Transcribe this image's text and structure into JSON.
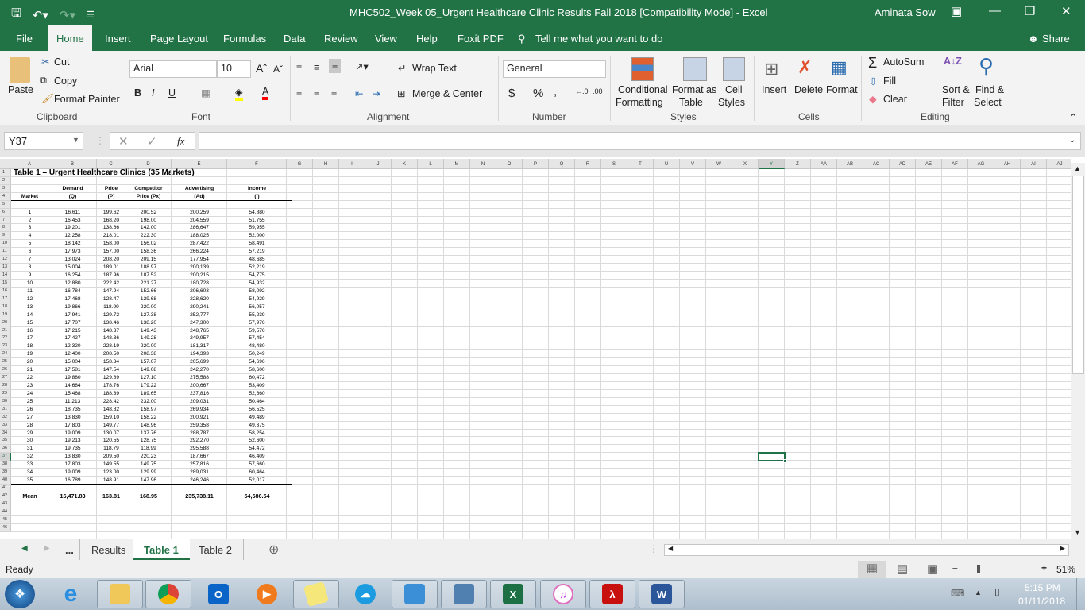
{
  "titlebar": {
    "title": "MHC502_Week 05_Urgent Healthcare Clinic Results Fall 2018  [Compatibility Mode]  -  Excel",
    "user": "Aminata Sow"
  },
  "tabs": [
    "File",
    "Home",
    "Insert",
    "Page Layout",
    "Formulas",
    "Data",
    "Review",
    "View",
    "Help",
    "Foxit PDF"
  ],
  "tell_me": "Tell me what you want to do",
  "share": "Share",
  "ribbon": {
    "clipboard": {
      "paste": "Paste",
      "cut": "Cut",
      "copy": "Copy",
      "format_painter": "Format Painter",
      "label": "Clipboard"
    },
    "font": {
      "name": "Arial",
      "size": "10",
      "label": "Font",
      "bold": "B",
      "italic": "I",
      "underline": "U"
    },
    "alignment": {
      "wrap_text": "Wrap Text",
      "merge_center": "Merge & Center",
      "label": "Alignment"
    },
    "number": {
      "format": "General",
      "currency": "$",
      "percent": "%",
      "comma": ",",
      "label": "Number"
    },
    "styles": {
      "conditional": "Conditional",
      "conditional2": "Formatting",
      "format_table": "Format as",
      "format_table2": "Table",
      "cell_styles": "Cell",
      "cell_styles2": "Styles",
      "label": "Styles"
    },
    "cells": {
      "insert": "Insert",
      "delete": "Delete",
      "format": "Format",
      "label": "Cells"
    },
    "editing": {
      "autosum": "AutoSum",
      "fill": "Fill",
      "clear": "Clear",
      "sort": "Sort &",
      "sort2": "Filter",
      "find": "Find &",
      "find2": "Select",
      "label": "Editing"
    }
  },
  "formula_bar": {
    "name_box": "Y37",
    "formula": "",
    "fx": "fx"
  },
  "columns": [
    "A",
    "B",
    "C",
    "D",
    "E",
    "F",
    "G",
    "H",
    "I",
    "J",
    "K",
    "L",
    "M",
    "N",
    "O",
    "P",
    "Q",
    "R",
    "S",
    "T",
    "U",
    "V",
    "W",
    "X",
    "Y",
    "Z",
    "AA",
    "AB",
    "AC",
    "AD",
    "AE",
    "AF",
    "AG",
    "AH",
    "AI",
    "AJ"
  ],
  "selected_cell": "Y37",
  "sheet": {
    "title": "Table 1 – Urgent Healthcare Clinics (35 Markets)",
    "headers_row3": [
      "",
      "Demand",
      "Price",
      "Competitor",
      "Advertising",
      "Income"
    ],
    "headers_row4": [
      "Market",
      "(Q)",
      "(P)",
      "Price (Px)",
      "(Ad)",
      "(I)"
    ],
    "rows": [
      [
        "1",
        "16,611",
        "199.62",
        "200.52",
        "200,259",
        "54,880"
      ],
      [
        "2",
        "16,453",
        "168.20",
        "198.00",
        "204,559",
        "51,755"
      ],
      [
        "3",
        "19,201",
        "138.66",
        "142.00",
        "286,647",
        "59,955"
      ],
      [
        "4",
        "12,258",
        "218.01",
        "222.30",
        "188,025",
        "52,000"
      ],
      [
        "5",
        "18,142",
        "158.00",
        "156.02",
        "287,422",
        "58,491"
      ],
      [
        "6",
        "17,973",
        "157.00",
        "158.36",
        "266,224",
        "57,219"
      ],
      [
        "7",
        "13,024",
        "208.20",
        "209.15",
        "177,954",
        "48,685"
      ],
      [
        "8",
        "15,004",
        "189.01",
        "188.97",
        "200,139",
        "52,219"
      ],
      [
        "9",
        "16,254",
        "187.96",
        "187.52",
        "200,215",
        "54,775"
      ],
      [
        "10",
        "12,880",
        "222.42",
        "221.27",
        "180,728",
        "54,932"
      ],
      [
        "11",
        "16,784",
        "147.94",
        "152.66",
        "206,603",
        "58,092"
      ],
      [
        "12",
        "17,468",
        "128.47",
        "129.68",
        "228,620",
        "54,929"
      ],
      [
        "13",
        "19,866",
        "118.99",
        "220.00",
        "290,241",
        "56,057"
      ],
      [
        "14",
        "17,941",
        "129.72",
        "127.38",
        "252,777",
        "55,239"
      ],
      [
        "15",
        "17,707",
        "138.46",
        "138.20",
        "247,300",
        "57,976"
      ],
      [
        "16",
        "17,215",
        "148.37",
        "149.43",
        "248,765",
        "59,576"
      ],
      [
        "17",
        "17,427",
        "148.36",
        "149.28",
        "249,957",
        "57,454"
      ],
      [
        "18",
        "12,320",
        "228.19",
        "220.00",
        "181,317",
        "48,480"
      ],
      [
        "19",
        "12,400",
        "208.50",
        "208.38",
        "194,393",
        "50,249"
      ],
      [
        "20",
        "15,004",
        "158.34",
        "157.67",
        "205,699",
        "54,696"
      ],
      [
        "21",
        "17,581",
        "147.54",
        "149.08",
        "242,270",
        "58,600"
      ],
      [
        "22",
        "19,880",
        "129.89",
        "127.10",
        "275,588",
        "60,472"
      ],
      [
        "23",
        "14,684",
        "178.76",
        "179.22",
        "200,667",
        "53,409"
      ],
      [
        "24",
        "15,468",
        "188.39",
        "189.65",
        "237,816",
        "52,660"
      ],
      [
        "25",
        "11,213",
        "228.42",
        "232.00",
        "209,031",
        "50,464"
      ],
      [
        "26",
        "18,735",
        "148.82",
        "158.97",
        "269,934",
        "56,525"
      ],
      [
        "27",
        "13,830",
        "159.10",
        "158.22",
        "200,921",
        "49,489"
      ],
      [
        "28",
        "17,803",
        "149.77",
        "148.96",
        "259,358",
        "49,375"
      ],
      [
        "29",
        "19,009",
        "130.07",
        "137.76",
        "288,787",
        "58,254"
      ],
      [
        "30",
        "19,213",
        "120.55",
        "128.75",
        "292,270",
        "52,600"
      ],
      [
        "31",
        "19,735",
        "118.79",
        "118.99",
        "295,588",
        "54,472"
      ],
      [
        "32",
        "13,830",
        "209.50",
        "220.23",
        "187,667",
        "46,409"
      ],
      [
        "33",
        "17,803",
        "149.55",
        "149.75",
        "257,816",
        "57,660"
      ],
      [
        "34",
        "19,009",
        "123.00",
        "129.99",
        "289,031",
        "60,464"
      ],
      [
        "35",
        "16,789",
        "148.91",
        "147.96",
        "246,246",
        "52,017"
      ]
    ],
    "mean": [
      "Mean",
      "16,471.83",
      "163.81",
      "168.95",
      "235,738.11",
      "54,586.54"
    ]
  },
  "sheet_tabs": {
    "more": "...",
    "tabs": [
      "Results",
      "Table 1",
      "Table 2"
    ],
    "active": "Table 1"
  },
  "status": {
    "ready": "Ready",
    "zoom": "51%",
    "zoom_level_percent": 51
  },
  "taskbar": {
    "time": "5:15 PM",
    "date": "01/11/2018",
    "apps": [
      "internet-explorer",
      "file-explorer",
      "chrome",
      "outlook",
      "media-player",
      "sticky-notes",
      "onedrive",
      "control-panel",
      "network",
      "excel",
      "itunes",
      "acrobat",
      "word"
    ]
  },
  "colors": {
    "excel_green": "#217346",
    "ribbon_bg": "#f3f3f3"
  }
}
